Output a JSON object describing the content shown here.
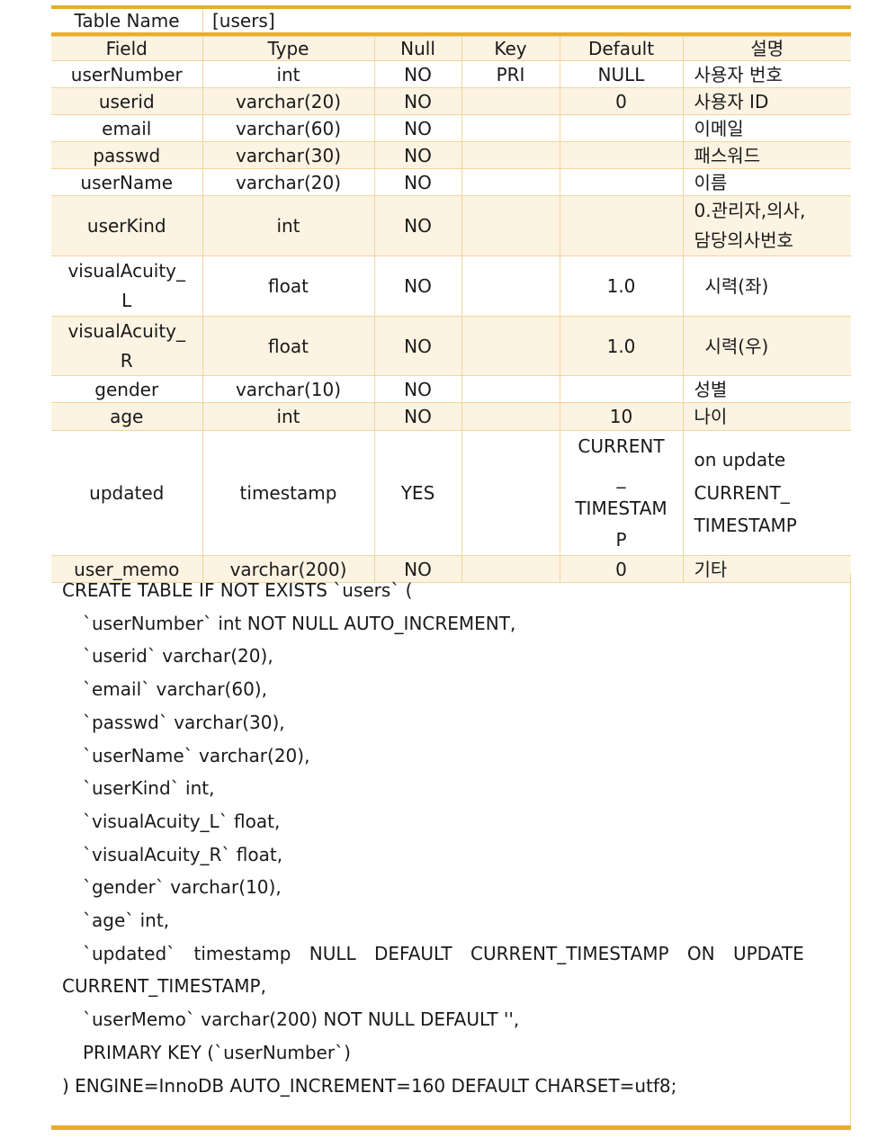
{
  "table_name": {
    "label": "Table Name",
    "value": "[users]"
  },
  "columns": [
    "Field",
    "Type",
    "Null",
    "Key",
    "Default",
    "설명"
  ],
  "rows": [
    {
      "field": "userNumber",
      "type": "int",
      "null": "NO",
      "key": "PRI",
      "default": "NULL",
      "desc": "사용자 번호"
    },
    {
      "field": "userid",
      "type": "varchar(20)",
      "null": "NO",
      "key": "",
      "default": "0",
      "desc": "사용자 ID"
    },
    {
      "field": "email",
      "type": "varchar(60)",
      "null": "NO",
      "key": "",
      "default": "",
      "desc": "이메일"
    },
    {
      "field": "passwd",
      "type": "varchar(30)",
      "null": "NO",
      "key": "",
      "default": "",
      "desc": "패스워드"
    },
    {
      "field": "userName",
      "type": "varchar(20)",
      "null": "NO",
      "key": "",
      "default": "",
      "desc": "이름"
    },
    {
      "field": "userKind",
      "type": "int",
      "null": "NO",
      "key": "",
      "default": "",
      "desc": "0.관리자,의사,\n담당의사번호"
    },
    {
      "field": "visualAcuity_\nL",
      "type": "float",
      "null": "NO",
      "key": "",
      "default": "1.0",
      "desc": "시력(좌)"
    },
    {
      "field": "visualAcuity_\nR",
      "type": "float",
      "null": "NO",
      "key": "",
      "default": "1.0",
      "desc": "시력(우)"
    },
    {
      "field": "gender",
      "type": "varchar(10)",
      "null": "NO",
      "key": "",
      "default": "",
      "desc": "성별"
    },
    {
      "field": "age",
      "type": "int",
      "null": "NO",
      "key": "",
      "default": "10",
      "desc": "나이"
    },
    {
      "field": "updated",
      "type": "timestamp",
      "null": "YES",
      "key": "",
      "default": "CURRENT\n_\nTIMESTAM\nP",
      "desc": "on update\nCURRENT_\nTIMESTAMP"
    },
    {
      "field": "user_memo",
      "type": "varchar(200)",
      "null": "NO",
      "key": "",
      "default": "0",
      "desc": "기타"
    }
  ],
  "sql": [
    "CREATE TABLE IF NOT EXISTS `users` (",
    "`userNumber` int NOT NULL AUTO_INCREMENT,",
    "`userid` varchar(20),",
    "`email` varchar(60),",
    "`passwd` varchar(30),",
    "`userName` varchar(20),",
    "`userKind` int,",
    "`visualAcuity_L` float,",
    "`visualAcuity_R` float,",
    "`gender` varchar(10),",
    "`age` int,",
    "`updated` timestamp NULL DEFAULT CURRENT_TIMESTAMP ON UPDATE",
    "CURRENT_TIMESTAMP,",
    "`userMemo` varchar(200) NOT NULL DEFAULT '',",
    "PRIMARY KEY (`userNumber`)",
    ") ENGINE=InnoDB AUTO_INCREMENT=160 DEFAULT CHARSET=utf8;"
  ],
  "colors": {
    "accent": "#e8ad2e",
    "grid": "#f2d69a",
    "shade": "#fcf3e2"
  }
}
